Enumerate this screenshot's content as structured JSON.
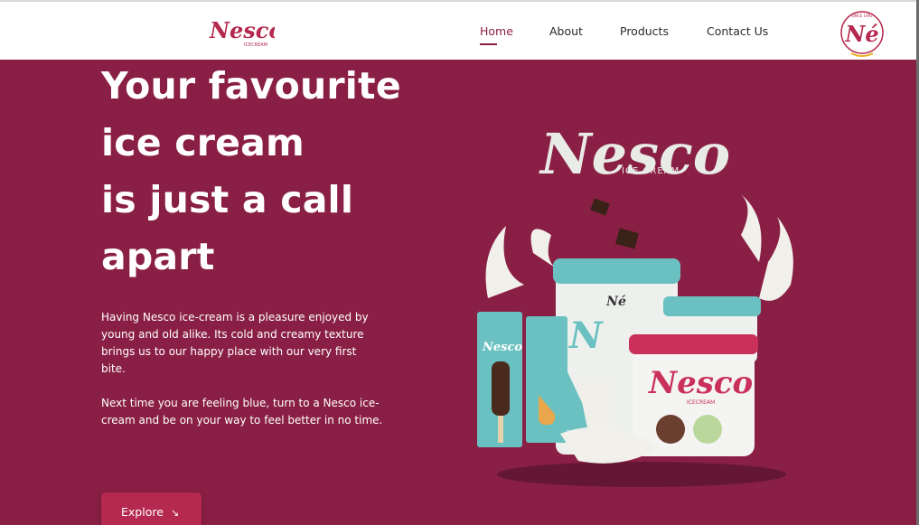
{
  "header": {
    "brand_logo_text": "Nesco",
    "brand_logo_sub": "ICECREAM",
    "badge_logo_text": "Né",
    "badge_logo_ring": "SINCE 1992",
    "nav": [
      {
        "label": "Home",
        "active": true
      },
      {
        "label": "About",
        "active": false
      },
      {
        "label": "Products",
        "active": false
      },
      {
        "label": "Contact Us",
        "active": false
      }
    ]
  },
  "hero": {
    "title_lines": [
      "Your favourite",
      "ice cream",
      "is just a call",
      "apart"
    ],
    "paragraph_1": "Having Nesco ice-cream is a pleasure enjoyed by young and old alike. Its cold and creamy texture brings us to our happy place with our very first bite.",
    "paragraph_2": "Next time you are feeling blue, turn to a Nesco ice-cream and be on your way to feel better in no time.",
    "cta_label": "Explore",
    "cta_icon": "arrow-down-right-icon"
  },
  "product_image": {
    "logo_text": "Nesco",
    "logo_sub": "ICE CREAM",
    "tub_label": "Nesco",
    "tub_sub": "ICECREAM",
    "bar_label": "Nesco",
    "lid_mark": "Né"
  },
  "colors": {
    "background": "#8a1f45",
    "accent": "#b5294f",
    "teal": "#5fb8b8",
    "nav_text": "#2a2a2a",
    "white": "#ffffff"
  }
}
